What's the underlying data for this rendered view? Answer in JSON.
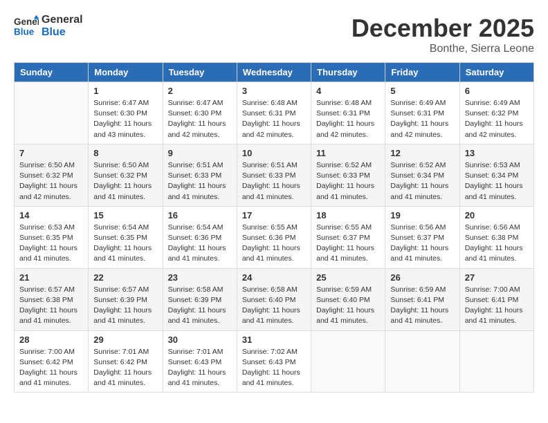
{
  "header": {
    "logo_line1": "General",
    "logo_line2": "Blue",
    "month": "December 2025",
    "location": "Bonthe, Sierra Leone"
  },
  "days_of_week": [
    "Sunday",
    "Monday",
    "Tuesday",
    "Wednesday",
    "Thursday",
    "Friday",
    "Saturday"
  ],
  "weeks": [
    [
      {
        "day": "",
        "info": ""
      },
      {
        "day": "1",
        "info": "Sunrise: 6:47 AM\nSunset: 6:30 PM\nDaylight: 11 hours\nand 43 minutes."
      },
      {
        "day": "2",
        "info": "Sunrise: 6:47 AM\nSunset: 6:30 PM\nDaylight: 11 hours\nand 42 minutes."
      },
      {
        "day": "3",
        "info": "Sunrise: 6:48 AM\nSunset: 6:31 PM\nDaylight: 11 hours\nand 42 minutes."
      },
      {
        "day": "4",
        "info": "Sunrise: 6:48 AM\nSunset: 6:31 PM\nDaylight: 11 hours\nand 42 minutes."
      },
      {
        "day": "5",
        "info": "Sunrise: 6:49 AM\nSunset: 6:31 PM\nDaylight: 11 hours\nand 42 minutes."
      },
      {
        "day": "6",
        "info": "Sunrise: 6:49 AM\nSunset: 6:32 PM\nDaylight: 11 hours\nand 42 minutes."
      }
    ],
    [
      {
        "day": "7",
        "info": "Sunrise: 6:50 AM\nSunset: 6:32 PM\nDaylight: 11 hours\nand 42 minutes."
      },
      {
        "day": "8",
        "info": "Sunrise: 6:50 AM\nSunset: 6:32 PM\nDaylight: 11 hours\nand 41 minutes."
      },
      {
        "day": "9",
        "info": "Sunrise: 6:51 AM\nSunset: 6:33 PM\nDaylight: 11 hours\nand 41 minutes."
      },
      {
        "day": "10",
        "info": "Sunrise: 6:51 AM\nSunset: 6:33 PM\nDaylight: 11 hours\nand 41 minutes."
      },
      {
        "day": "11",
        "info": "Sunrise: 6:52 AM\nSunset: 6:33 PM\nDaylight: 11 hours\nand 41 minutes."
      },
      {
        "day": "12",
        "info": "Sunrise: 6:52 AM\nSunset: 6:34 PM\nDaylight: 11 hours\nand 41 minutes."
      },
      {
        "day": "13",
        "info": "Sunrise: 6:53 AM\nSunset: 6:34 PM\nDaylight: 11 hours\nand 41 minutes."
      }
    ],
    [
      {
        "day": "14",
        "info": "Sunrise: 6:53 AM\nSunset: 6:35 PM\nDaylight: 11 hours\nand 41 minutes."
      },
      {
        "day": "15",
        "info": "Sunrise: 6:54 AM\nSunset: 6:35 PM\nDaylight: 11 hours\nand 41 minutes."
      },
      {
        "day": "16",
        "info": "Sunrise: 6:54 AM\nSunset: 6:36 PM\nDaylight: 11 hours\nand 41 minutes."
      },
      {
        "day": "17",
        "info": "Sunrise: 6:55 AM\nSunset: 6:36 PM\nDaylight: 11 hours\nand 41 minutes."
      },
      {
        "day": "18",
        "info": "Sunrise: 6:55 AM\nSunset: 6:37 PM\nDaylight: 11 hours\nand 41 minutes."
      },
      {
        "day": "19",
        "info": "Sunrise: 6:56 AM\nSunset: 6:37 PM\nDaylight: 11 hours\nand 41 minutes."
      },
      {
        "day": "20",
        "info": "Sunrise: 6:56 AM\nSunset: 6:38 PM\nDaylight: 11 hours\nand 41 minutes."
      }
    ],
    [
      {
        "day": "21",
        "info": "Sunrise: 6:57 AM\nSunset: 6:38 PM\nDaylight: 11 hours\nand 41 minutes."
      },
      {
        "day": "22",
        "info": "Sunrise: 6:57 AM\nSunset: 6:39 PM\nDaylight: 11 hours\nand 41 minutes."
      },
      {
        "day": "23",
        "info": "Sunrise: 6:58 AM\nSunset: 6:39 PM\nDaylight: 11 hours\nand 41 minutes."
      },
      {
        "day": "24",
        "info": "Sunrise: 6:58 AM\nSunset: 6:40 PM\nDaylight: 11 hours\nand 41 minutes."
      },
      {
        "day": "25",
        "info": "Sunrise: 6:59 AM\nSunset: 6:40 PM\nDaylight: 11 hours\nand 41 minutes."
      },
      {
        "day": "26",
        "info": "Sunrise: 6:59 AM\nSunset: 6:41 PM\nDaylight: 11 hours\nand 41 minutes."
      },
      {
        "day": "27",
        "info": "Sunrise: 7:00 AM\nSunset: 6:41 PM\nDaylight: 11 hours\nand 41 minutes."
      }
    ],
    [
      {
        "day": "28",
        "info": "Sunrise: 7:00 AM\nSunset: 6:42 PM\nDaylight: 11 hours\nand 41 minutes."
      },
      {
        "day": "29",
        "info": "Sunrise: 7:01 AM\nSunset: 6:42 PM\nDaylight: 11 hours\nand 41 minutes."
      },
      {
        "day": "30",
        "info": "Sunrise: 7:01 AM\nSunset: 6:43 PM\nDaylight: 11 hours\nand 41 minutes."
      },
      {
        "day": "31",
        "info": "Sunrise: 7:02 AM\nSunset: 6:43 PM\nDaylight: 11 hours\nand 41 minutes."
      },
      {
        "day": "",
        "info": ""
      },
      {
        "day": "",
        "info": ""
      },
      {
        "day": "",
        "info": ""
      }
    ]
  ]
}
